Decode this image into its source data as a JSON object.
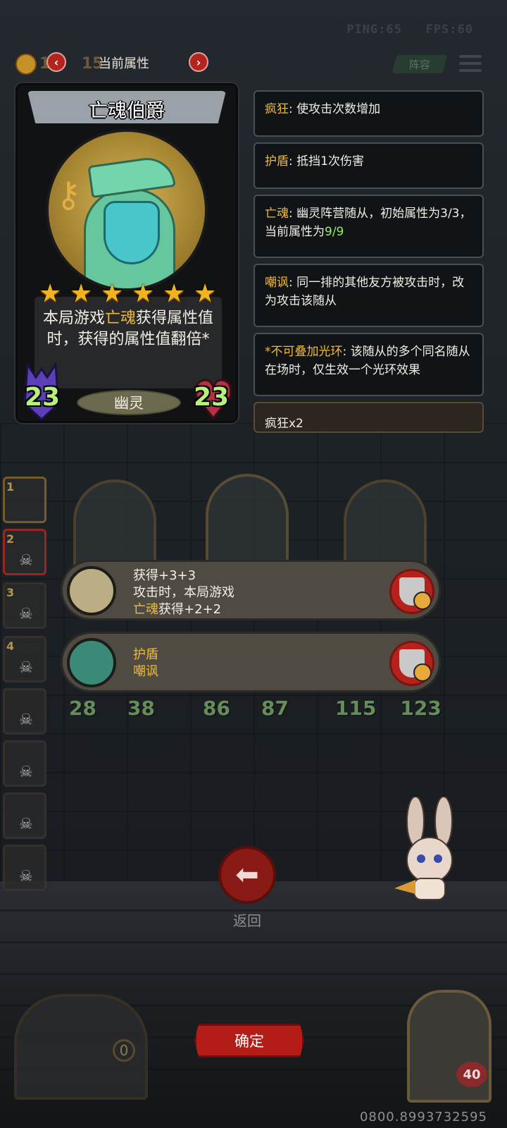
{
  "status": {
    "ping": "PING:65",
    "fps": "FPS:60"
  },
  "header": {
    "coin_value": "10",
    "round": "15",
    "title": "当前属性",
    "lineup_label": "阵容"
  },
  "card": {
    "name": "亡魂伯爵",
    "stars": 6,
    "desc_pre": "本局游戏",
    "desc_highlight": "亡魂",
    "desc_post": "获得属性值时，获得的属性值翻倍*",
    "attack": "23",
    "health": "23",
    "tribe": "幽灵"
  },
  "keywords": [
    {
      "key": "疯狂",
      "text": ": 使攻击次数增加"
    },
    {
      "key": "护盾",
      "text": ": 抵挡1次伤害"
    },
    {
      "key": "亡魂",
      "text": ": 幽灵阵营随从，初始属性为3/3，当前属性为",
      "value": "9/9"
    },
    {
      "key": "嘲讽",
      "text": ": 同一排的其他友方被攻击时，改为攻击该随从"
    },
    {
      "key": "*不可叠加光环",
      "text": ": 该随从的多个同名随从在场时，仅生效一个光环效果"
    },
    {
      "key": "",
      "text": "疯狂x2"
    }
  ],
  "side_slots": [
    "1",
    "2",
    "3",
    "4",
    "",
    "",
    "",
    ""
  ],
  "buffs": [
    {
      "line1": "获得+3+3",
      "line2": "攻击时，本局游戏",
      "line3_key": "亡魂",
      "line3": "获得+2+2"
    },
    {
      "line1": "护盾",
      "line2": "嘲讽"
    }
  ],
  "board_stats": [
    {
      "atk": "28",
      "hp": "38"
    },
    {
      "atk": "86",
      "hp": "87"
    },
    {
      "atk": "115",
      "hp": "123"
    }
  ],
  "back_label": "返回",
  "confirm_label": "确定",
  "gold": "0",
  "player_level": "40",
  "bottom_id": "0800.8993732595",
  "colors": {
    "accent_gold": "#f0b93b",
    "stat_green": "#b8f07d",
    "button_red": "#b31c17"
  }
}
